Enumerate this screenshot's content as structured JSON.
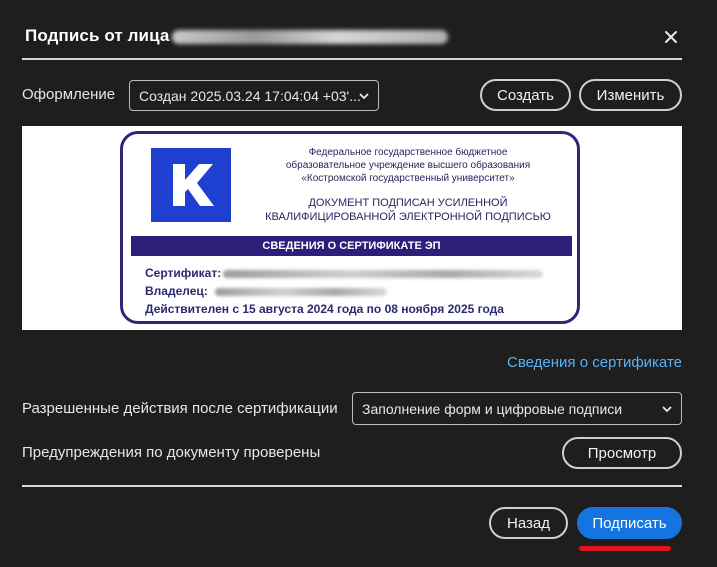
{
  "dialog": {
    "title": "Подпись от лица",
    "close_icon": "close-icon"
  },
  "appearance": {
    "label": "Оформление",
    "selected": "Создан 2025.03.24 17:04:04 +03'...",
    "create_label": "Создать",
    "edit_label": "Изменить"
  },
  "stamp": {
    "logo_letter": "K",
    "org_lines": [
      "Федеральное государственное бюджетное",
      "образовательное учреждение высшего образования",
      "«Костромской государственный университет»"
    ],
    "signed_lines": [
      "ДОКУМЕНТ ПОДПИСАН УСИЛЕННОЙ",
      "КВАЛИФИЦИРОВАННОЙ ЭЛЕКТРОННОЙ ПОДПИСЬЮ"
    ],
    "band_title": "СВЕДЕНИЯ О СЕРТИФИКАТЕ ЭП",
    "certificate_label": "Сертификат:",
    "owner_label": "Владелец:",
    "validity": "Действителен с 15 августа 2024 года по 08 ноября 2025 года",
    "colors": {
      "frame": "#2b2878",
      "logo": "#1f3fd0",
      "band": "#2b1f7a"
    }
  },
  "certificate_link": "Сведения о сертификате",
  "permissions": {
    "label": "Разрешенные действия после сертификации",
    "selected": "Заполнение форм и цифровые подписи"
  },
  "warnings": {
    "label": "Предупреждения по документу проверены",
    "view_label": "Просмотр"
  },
  "footer": {
    "back_label": "Назад",
    "sign_label": "Подписать"
  },
  "colors": {
    "accent": "#1474e0",
    "link": "#55b2f2",
    "highlight": "#e0151b"
  }
}
